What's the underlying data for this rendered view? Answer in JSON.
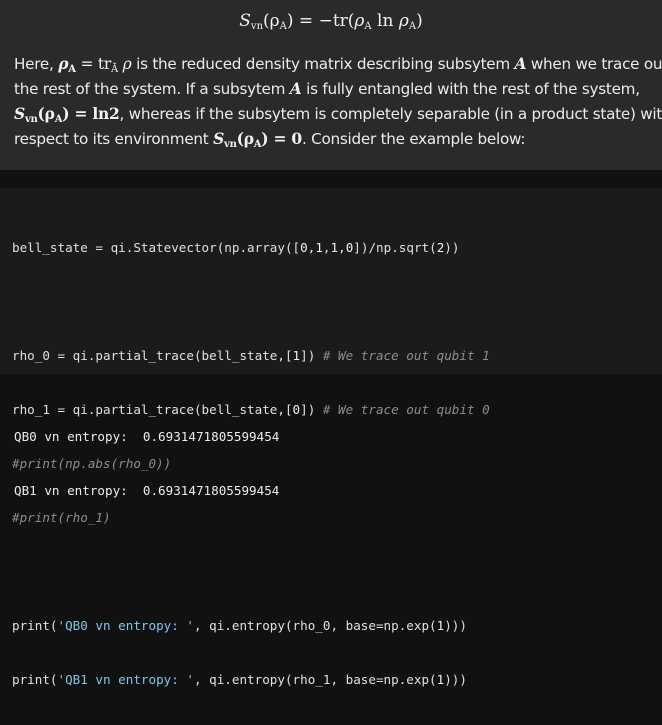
{
  "markdown": {
    "equation": {
      "lhs_symbol": "S",
      "lhs_sub": "vn",
      "lhs_arg": "(ρ",
      "lhs_arg_sub": "A",
      "lhs_close": ")",
      "eq": " = −tr(",
      "rho1": "ρ",
      "rho1_sub": "A",
      "ln": " ln ",
      "rho2": "ρ",
      "rho2_sub": "A",
      "rhs_close": ")"
    },
    "para": {
      "l1_a": "Here, ",
      "l1_rho": "ρ",
      "l1_rho_sub": "A",
      "l1_eq": " = tr",
      "l1_tr_sub": "Ā",
      "l1_rho2": " ρ",
      "l1_b": " is the reduced density matrix describing subsytem ",
      "l1_A": "A",
      "l1_c": " when we trace out",
      "l2_a": "the rest of the system. If a subsytem ",
      "l2_A": "A",
      "l2_b": " is fully entangled with the rest of the system,",
      "l3_S": "S",
      "l3_S_sub": "vn",
      "l3_arg": "(ρ",
      "l3_arg_sub": "A",
      "l3_eq": ") = ln2",
      "l3_b": ", whereas if the subsytem is completely separable (in a product state) with",
      "l4_a": "respect to its environment ",
      "l4_S": "S",
      "l4_S_sub": "vn",
      "l4_arg": "(ρ",
      "l4_arg_sub": "A",
      "l4_eq": ") = 0",
      "l4_b": ". Consider the example below:"
    }
  },
  "code": {
    "line1": {
      "a": "bell_state = qi.Statevector(np.array([",
      "n1": "0",
      "c1": ",",
      "n2": "1",
      "c2": ",",
      "n3": "1",
      "c3": ",",
      "n4": "0",
      "b": "])/np.sqrt(",
      "n5": "2",
      "c": "))"
    },
    "line2": {
      "a": "rho_0 = qi.partial_trace(bell_state,[",
      "n": "1",
      "b": "]) ",
      "comment": "# We trace out qubit 1"
    },
    "line3": {
      "a": "rho_1 = qi.partial_trace(bell_state,[",
      "n": "0",
      "b": "]) ",
      "comment": "# We trace out qubit 0"
    },
    "line4": "#print(np.abs(rho_0))",
    "line5": "#print(rho_1)",
    "line6": {
      "a": "print(",
      "str": "'QB0 vn entropy: '",
      "b": ", qi.entropy(rho_0, base=np.exp(",
      "n": "1",
      "c": ")))"
    },
    "line7": {
      "a": "print(",
      "str": "'QB1 vn entropy: '",
      "b": ", qi.entropy(rho_1, base=np.exp(",
      "n": "1",
      "c": ")))"
    }
  },
  "output": {
    "line1": "QB0 vn entropy:  0.6931471805599454",
    "line2": "QB1 vn entropy:  0.6931471805599454"
  },
  "colors": {
    "markdown_bg": "#2a2a2a",
    "code_bg": "#1b1b1b",
    "page_bg": "#111111",
    "string": "#7ec7e8",
    "comment": "#8c8c8c"
  }
}
